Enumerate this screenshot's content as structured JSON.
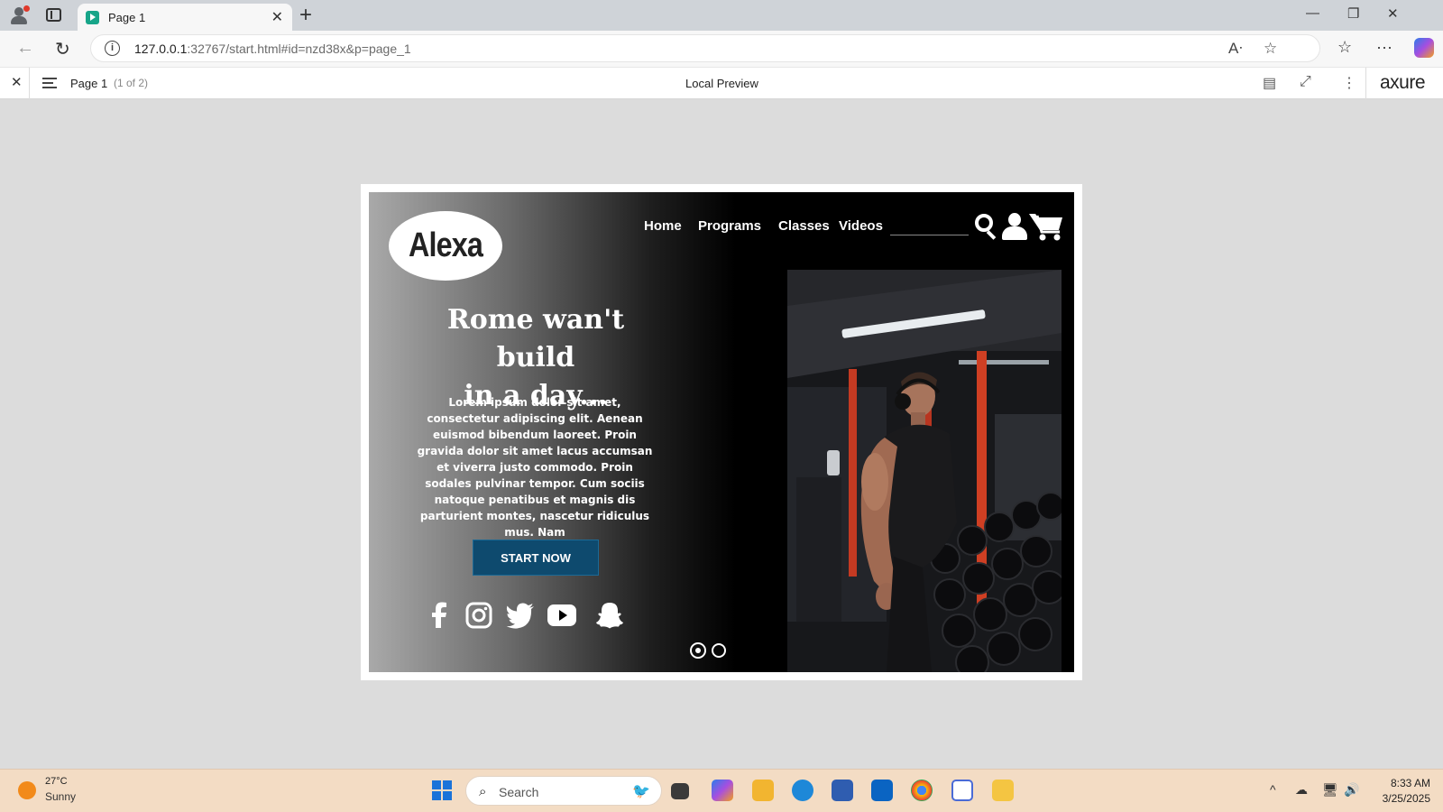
{
  "browser": {
    "tab_title": "Page 1",
    "url_host": "127.0.0.1",
    "url_rest": ":32767/start.html#id=nzd38x&p=page_1"
  },
  "axure": {
    "page_name": "Page 1",
    "page_count": "(1 of 2)",
    "center_label": "Local Preview",
    "logo": "axure"
  },
  "site": {
    "logo_text": "Alexa",
    "nav": [
      "Home",
      "Programs",
      "Classes",
      "Videos"
    ],
    "headline_line1": "Rome wan't build",
    "headline_line2": "in a day...",
    "body_text": "Lorem ipsum dolor sit amet, consectetur adipiscing elit. Aenean euismod bibendum laoreet. Proin gravida dolor sit amet lacus accumsan et viverra justo commodo. Proin sodales pulvinar tempor. Cum sociis natoque penatibus et magnis dis parturient montes, nascetur ridiculus mus. Nam",
    "cta_label": "START NOW",
    "social_icons": [
      "facebook-icon",
      "instagram-icon",
      "twitter-icon",
      "youtube-icon",
      "snapchat-icon"
    ],
    "accent_color": "#0e4a6e",
    "slides_total": 2,
    "slide_active": 1
  },
  "taskbar": {
    "temperature": "27°C",
    "weather": "Sunny",
    "search_placeholder": "Search",
    "time": "8:33 AM",
    "date": "3/25/2025"
  }
}
